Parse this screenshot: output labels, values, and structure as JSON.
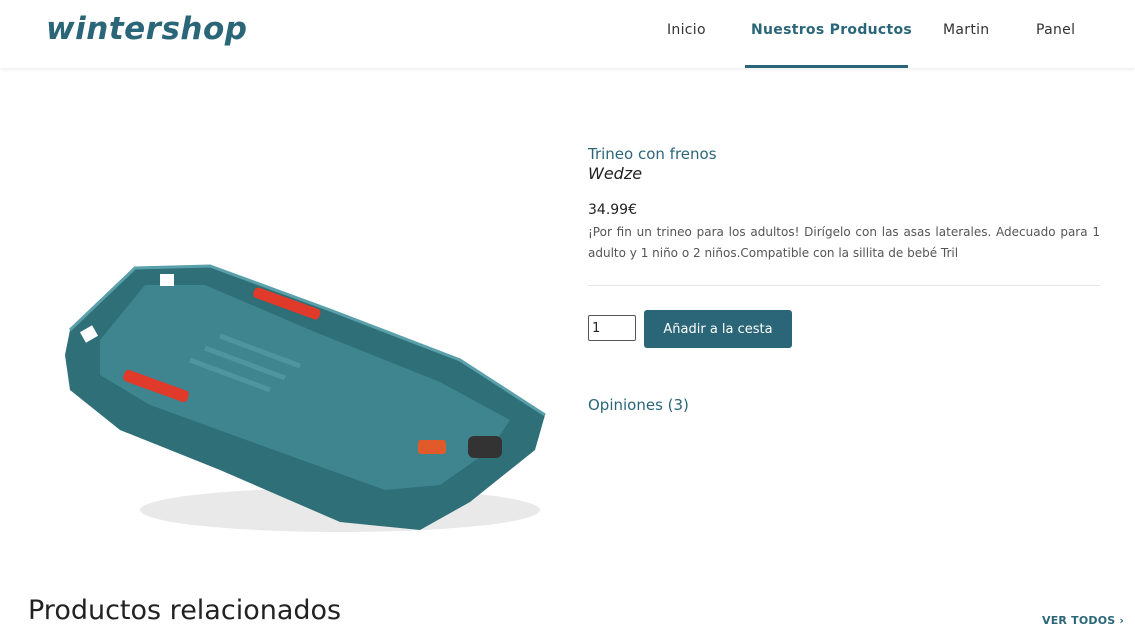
{
  "header": {
    "logo": "wintershop",
    "nav": [
      {
        "label": "Inicio"
      },
      {
        "label": "Nuestros Productos"
      },
      {
        "label": "Martin"
      },
      {
        "label": "Panel"
      }
    ]
  },
  "product": {
    "title": "Trineo con frenos",
    "brand": "Wedze",
    "price": "34.99€",
    "description": "¡Por fin un trineo para los adultos! Dirígelo con las asas laterales. Adecuado para 1 adulto y 1 niño o 2 niños.Compatible con la sillita de bebé Tril",
    "quantity": "1",
    "add_to_cart_label": "Añadir a la cesta",
    "reviews_label": "Opiniones (3)",
    "image_icon": "sled-image"
  },
  "related": {
    "title": "Productos relacionados",
    "see_all_label": "VER TODOS ›"
  },
  "colors": {
    "accent": "#2a6678",
    "sled": "#2e6f78",
    "handle": "#e03a2a"
  }
}
